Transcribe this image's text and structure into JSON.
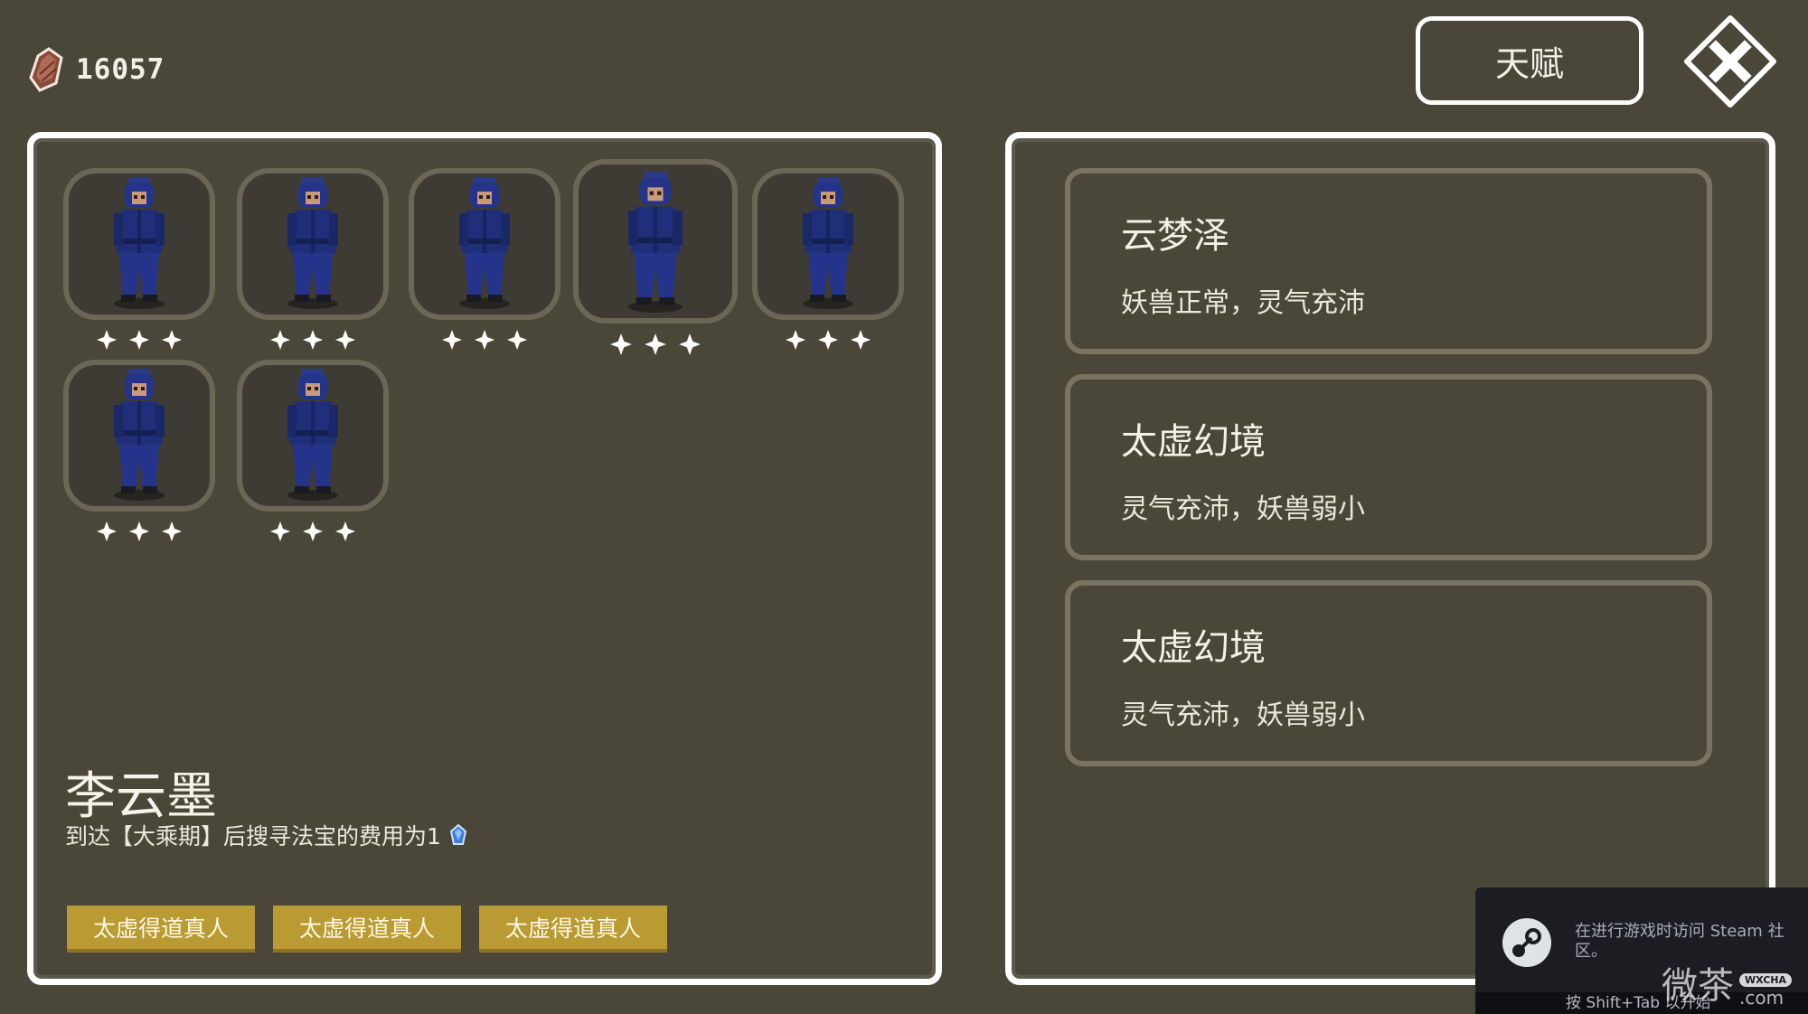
{
  "currency": {
    "icon": "spirit-stone-icon",
    "amount": "16057"
  },
  "header": {
    "talent_label": "天赋",
    "close_icon": "close-icon"
  },
  "characters": [
    {
      "stars": 3,
      "selected": false
    },
    {
      "stars": 3,
      "selected": false
    },
    {
      "stars": 3,
      "selected": false
    },
    {
      "stars": 3,
      "selected": true
    },
    {
      "stars": 3,
      "selected": false
    },
    {
      "stars": 3,
      "selected": false
    },
    {
      "stars": 3,
      "selected": false
    }
  ],
  "selected_character": {
    "name": "李云墨",
    "description": "到达【大乘期】后搜寻法宝的费用为1",
    "description_icon": "blue-gem-icon",
    "tags": [
      "太虚得道真人",
      "太虚得道真人",
      "太虚得道真人"
    ]
  },
  "realms": [
    {
      "title": "云梦泽",
      "subtitle": "妖兽正常，灵气充沛"
    },
    {
      "title": "太虚幻境",
      "subtitle": "灵气充沛，妖兽弱小"
    },
    {
      "title": "太虚幻境",
      "subtitle": "灵气充沛，妖兽弱小"
    }
  ],
  "steam_overlay": {
    "message": "在进行游戏时访问 Steam 社区。",
    "footer": "按 Shift+Tab 以开始"
  },
  "watermark": {
    "cn": "微茶",
    "badge": "WXCHA",
    "domain": ".com"
  },
  "colors": {
    "background": "#4a4739",
    "panel_border": "#ffffff",
    "card_border": "#79745f",
    "tag": "#b99a33",
    "robe": "#1f2f7a"
  }
}
